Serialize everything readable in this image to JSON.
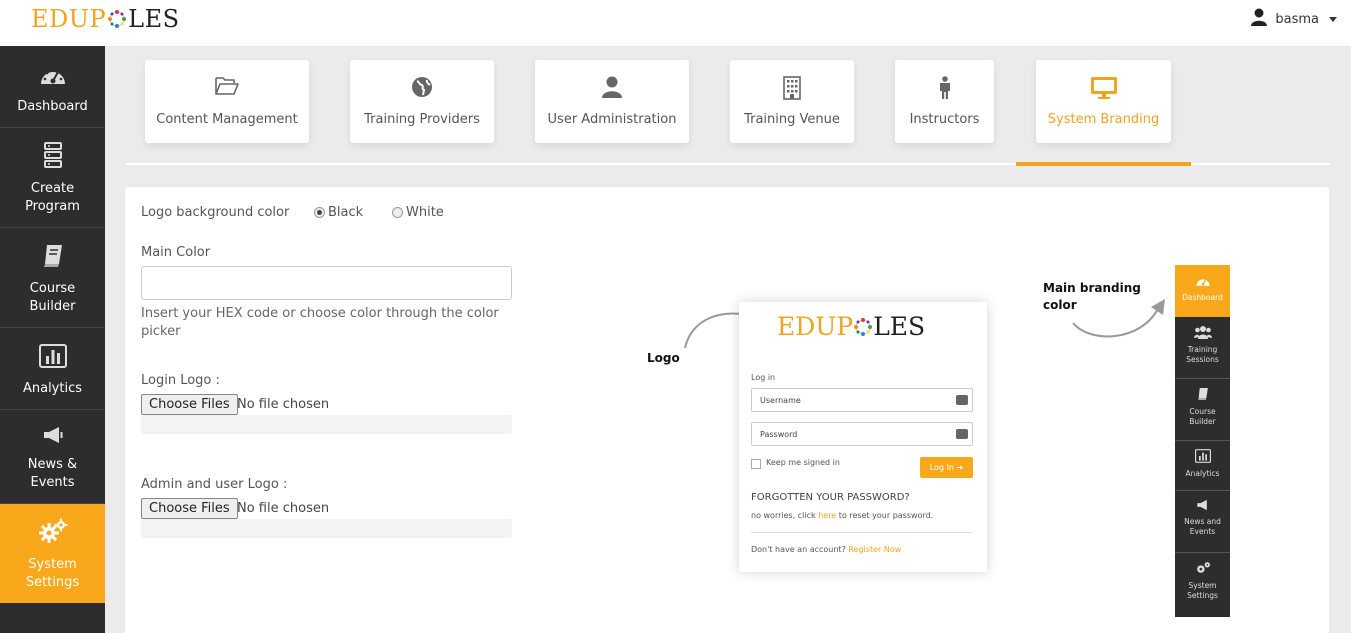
{
  "header": {
    "brand_prefix": "EDUP",
    "brand_suffix": "LES",
    "user_name": "basma"
  },
  "sidebar": {
    "items": [
      {
        "label": "Dashboard",
        "icon": "dashboard-icon"
      },
      {
        "label_line1": "Create",
        "label_line2": "Program",
        "icon": "server-icon"
      },
      {
        "label_line1": "Course",
        "label_line2": "Builder",
        "icon": "book-icon"
      },
      {
        "label": "Analytics",
        "icon": "bar-chart-icon"
      },
      {
        "label_line1": "News &",
        "label_line2": "Events",
        "icon": "megaphone-icon"
      },
      {
        "label_line1": "System",
        "label_line2": "Settings",
        "icon": "gears-icon",
        "active": true
      }
    ]
  },
  "tabs": [
    {
      "label": "Content Management",
      "icon": "folder-open-icon"
    },
    {
      "label": "Training Providers",
      "icon": "globe-icon"
    },
    {
      "label": "User Administration",
      "icon": "user-icon"
    },
    {
      "label": "Training Venue",
      "icon": "building-icon"
    },
    {
      "label": "Instructors",
      "icon": "person-icon"
    },
    {
      "label": "System Branding",
      "icon": "monitor-icon",
      "active": true
    }
  ],
  "form": {
    "logo_bg_label": "Logo background color",
    "logo_bg_options": [
      "Black",
      "White"
    ],
    "logo_bg_selected": "Black",
    "main_color_label": "Main Color",
    "main_color_value": "",
    "main_color_hint": "Insert your HEX code or choose color through the color picker",
    "login_logo_label": "Login Logo :",
    "admin_logo_label": "Admin and user Logo :",
    "choose_files": "Choose Files",
    "no_file": "No file chosen"
  },
  "preview": {
    "logo_label": "Logo",
    "branding_label_line1": "Main branding",
    "branding_label_line2": "color",
    "login": {
      "title": "Log in",
      "username": "Username",
      "password": "Password",
      "keep_signed": "Keep me signed in",
      "login_btn": "Log In",
      "forgot_title": "FORGOTTEN YOUR PASSWORD?",
      "forgot_pre": "no worries, click ",
      "forgot_link": "here",
      "forgot_post": " to reset your password.",
      "no_account": "Don't have an account? ",
      "register": "Register Now"
    },
    "mini_sidebar": [
      {
        "label": "Dashboard",
        "icon": "dashboard-icon",
        "active": true
      },
      {
        "label_line1": "Training",
        "label_line2": "Sessions",
        "icon": "users-icon"
      },
      {
        "label_line1": "Course",
        "label_line2": "Builder",
        "icon": "book-icon"
      },
      {
        "label": "Analytics",
        "icon": "bar-chart-icon"
      },
      {
        "label_line1": "News and",
        "label_line2": "Events",
        "icon": "megaphone-icon"
      },
      {
        "label_line1": "System",
        "label_line2": "Settings",
        "icon": "gears-icon"
      }
    ]
  },
  "colors": {
    "accent": "#f8a81a",
    "sidebar_bg": "#2d2d2d",
    "page_bg": "#ebebeb"
  }
}
